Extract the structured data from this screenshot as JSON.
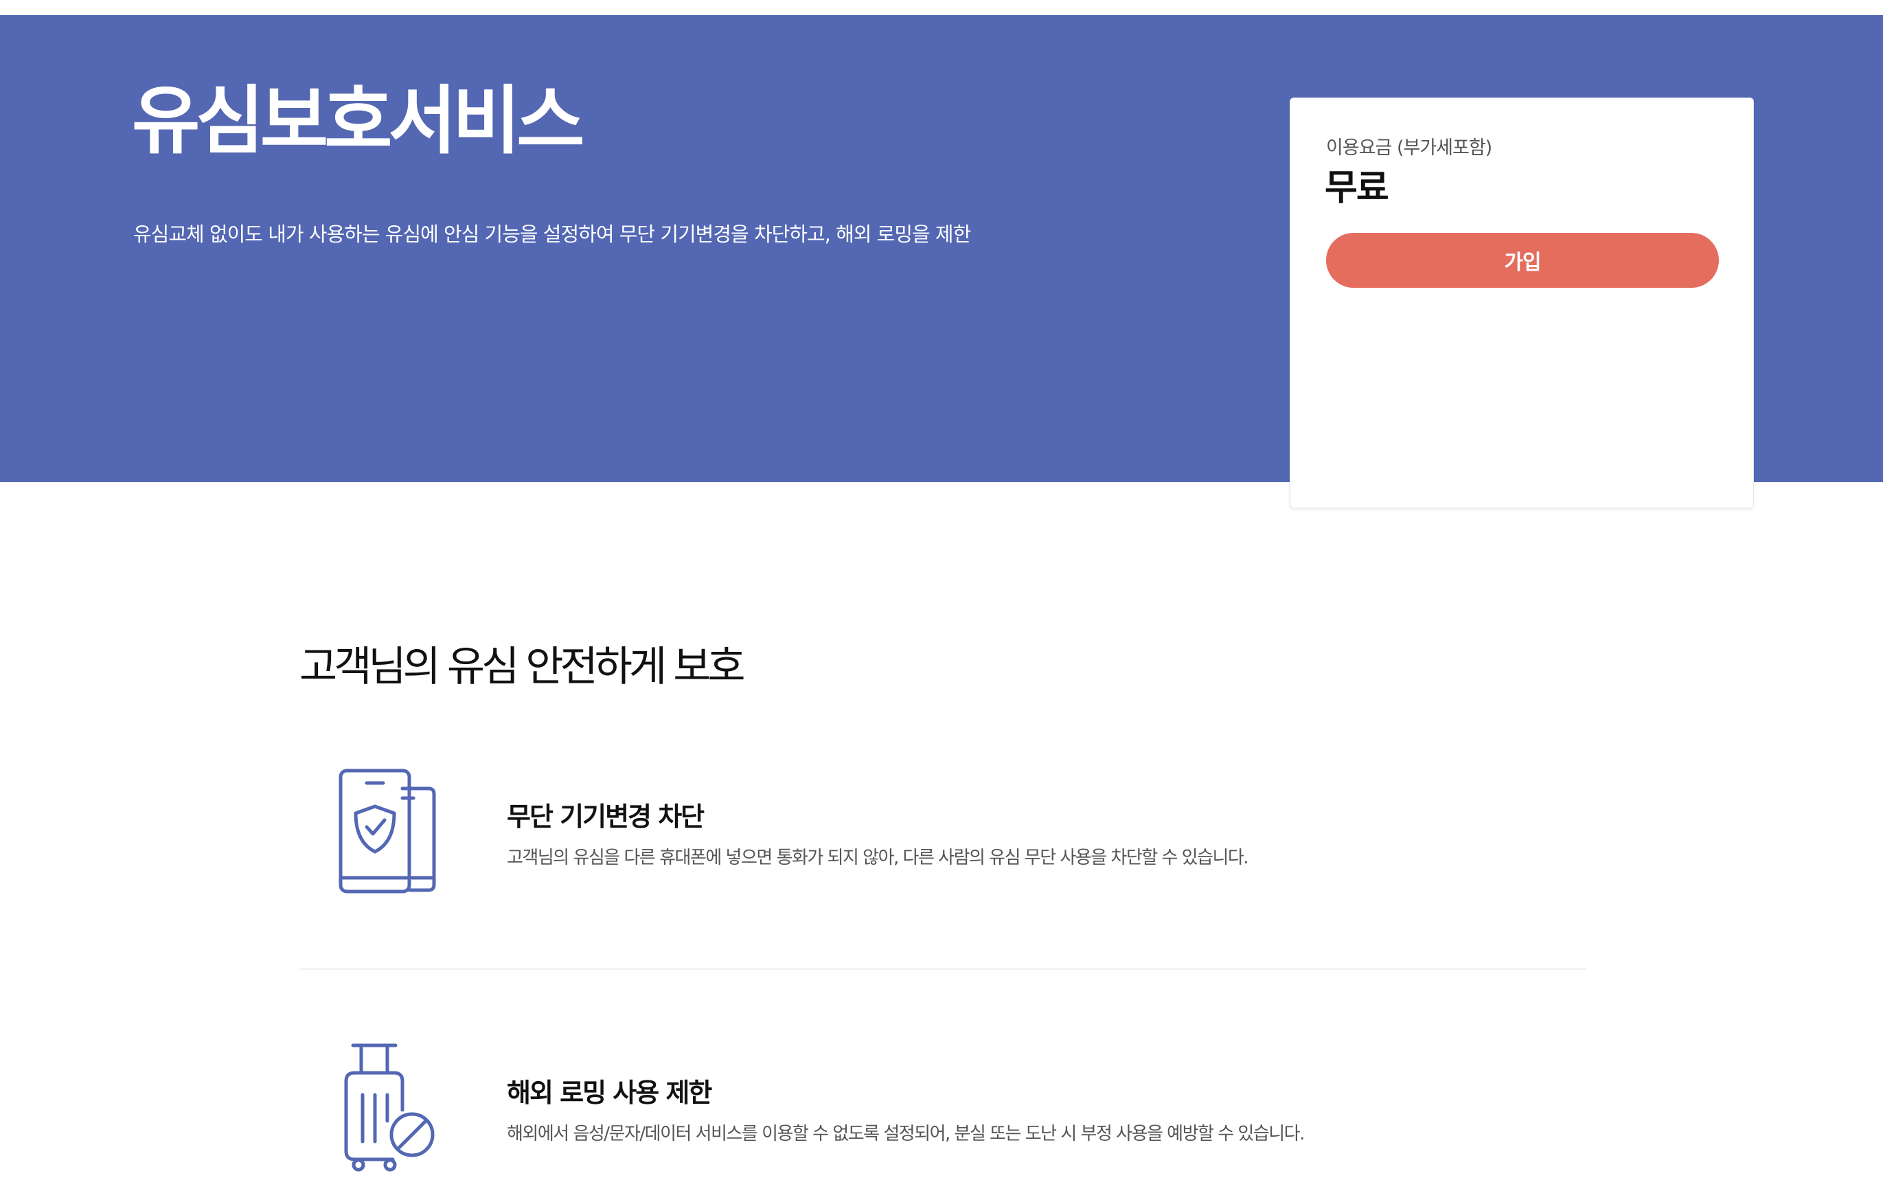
{
  "hero": {
    "title": "유심보호서비스",
    "description": "유심교체 없이도 내가 사용하는 유심에 안심 기능을 설정하여 무단 기기변경을 차단하고, 해외 로밍을 제한",
    "background_color": "#5367b3"
  },
  "price_card": {
    "label": "이용요금 (부가세포함)",
    "value": "무료",
    "join_label": "가입",
    "button_color": "#e46d5e"
  },
  "section": {
    "title": "고객님의 유심 안전하게 보호"
  },
  "features": [
    {
      "icon": "phone-shield-icon",
      "title": "무단 기기변경 차단",
      "description": "고객님의 유심을 다른 휴대폰에 넣으면 통화가 되지 않아, 다른 사람의 유심 무단 사용을 차단할 수 있습니다."
    },
    {
      "icon": "luggage-block-icon",
      "title": "해외 로밍 사용 제한",
      "description": "해외에서 음성/문자/데이터 서비스를 이용할 수 없도록 설정되어, 분실 또는 도난 시 부정 사용을 예방할 수 있습니다."
    }
  ],
  "icon_color": "#5367b3"
}
